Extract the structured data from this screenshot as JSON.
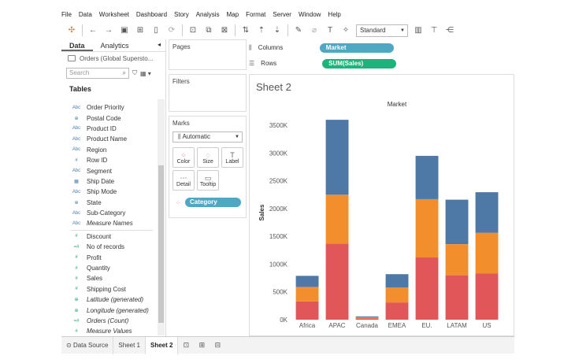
{
  "menu": [
    "File",
    "Data",
    "Worksheet",
    "Dashboard",
    "Story",
    "Analysis",
    "Map",
    "Format",
    "Server",
    "Window",
    "Help"
  ],
  "toolbar": {
    "fit_label": "Standard"
  },
  "data_pane": {
    "tabs": [
      "Data",
      "Analytics"
    ],
    "datasource": "Orders (Global Supersto...",
    "search_placeholder": "Search",
    "tables_label": "Tables",
    "dimensions": [
      {
        "type": "Abc",
        "name": "Order Priority"
      },
      {
        "type": "⊕",
        "name": "Postal Code"
      },
      {
        "type": "Abc",
        "name": "Product ID"
      },
      {
        "type": "Abc",
        "name": "Product Name"
      },
      {
        "type": "Abc",
        "name": "Region"
      },
      {
        "type": "#",
        "name": "Row ID"
      },
      {
        "type": "Abc",
        "name": "Segment"
      },
      {
        "type": "▦",
        "name": "Ship Date"
      },
      {
        "type": "Abc",
        "name": "Ship Mode"
      },
      {
        "type": "⊕",
        "name": "State"
      },
      {
        "type": "Abc",
        "name": "Sub-Category"
      },
      {
        "type": "Abc",
        "name": "Measure Names"
      }
    ],
    "measures": [
      {
        "type": "#",
        "name": "Discount"
      },
      {
        "type": "=#",
        "name": "No of records"
      },
      {
        "type": "#",
        "name": "Profit"
      },
      {
        "type": "#",
        "name": "Quantity"
      },
      {
        "type": "#",
        "name": "Sales"
      },
      {
        "type": "#",
        "name": "Shipping Cost"
      },
      {
        "type": "⊕",
        "name": "Latitude (generated)"
      },
      {
        "type": "⊕",
        "name": "Longitude (generated)"
      },
      {
        "type": "=#",
        "name": "Orders (Count)"
      },
      {
        "type": "#",
        "name": "Measure Values"
      }
    ]
  },
  "cards": {
    "pages": "Pages",
    "filters": "Filters",
    "marks": "Marks"
  },
  "marks": {
    "type": "Automatic",
    "buttons": [
      {
        "icon": "⁘",
        "label": "Color"
      },
      {
        "icon": "◌",
        "label": "Size"
      },
      {
        "icon": "T",
        "label": "Label"
      },
      {
        "icon": "⋯",
        "label": "Detail"
      },
      {
        "icon": "▭",
        "label": "Tooltip"
      }
    ],
    "category_pill": "Category"
  },
  "shelves": {
    "columns_label": "Columns",
    "columns_pill": "Market",
    "rows_label": "Rows",
    "rows_pill": "SUM(Sales)"
  },
  "sheet": {
    "title": "Sheet 2"
  },
  "bottom_tabs": {
    "datasource": "Data Source",
    "sheet1": "Sheet 1",
    "sheet2": "Sheet 2"
  },
  "chart_data": {
    "type": "bar",
    "stacked": true,
    "title": "Market",
    "ylabel": "Sales",
    "ylim": [
      0,
      3700
    ],
    "yticks": [
      "0K",
      "500K",
      "1000K",
      "1500K",
      "2000K",
      "2500K",
      "3000K",
      "3500K"
    ],
    "ytick_values": [
      0,
      500,
      1000,
      1500,
      2000,
      2500,
      3000,
      3500
    ],
    "categories": [
      "Africa",
      "APAC",
      "Canada",
      "EMEA",
      "EU.",
      "LATAM",
      "US"
    ],
    "series": [
      {
        "color": "#e15759",
        "values": [
          330,
          1370,
          25,
          310,
          1120,
          800,
          835
        ]
      },
      {
        "color": "#f28e2b",
        "values": [
          260,
          880,
          20,
          270,
          1050,
          560,
          730
        ]
      },
      {
        "color": "#4e79a7",
        "values": [
          200,
          1350,
          15,
          240,
          780,
          800,
          730
        ]
      }
    ]
  }
}
